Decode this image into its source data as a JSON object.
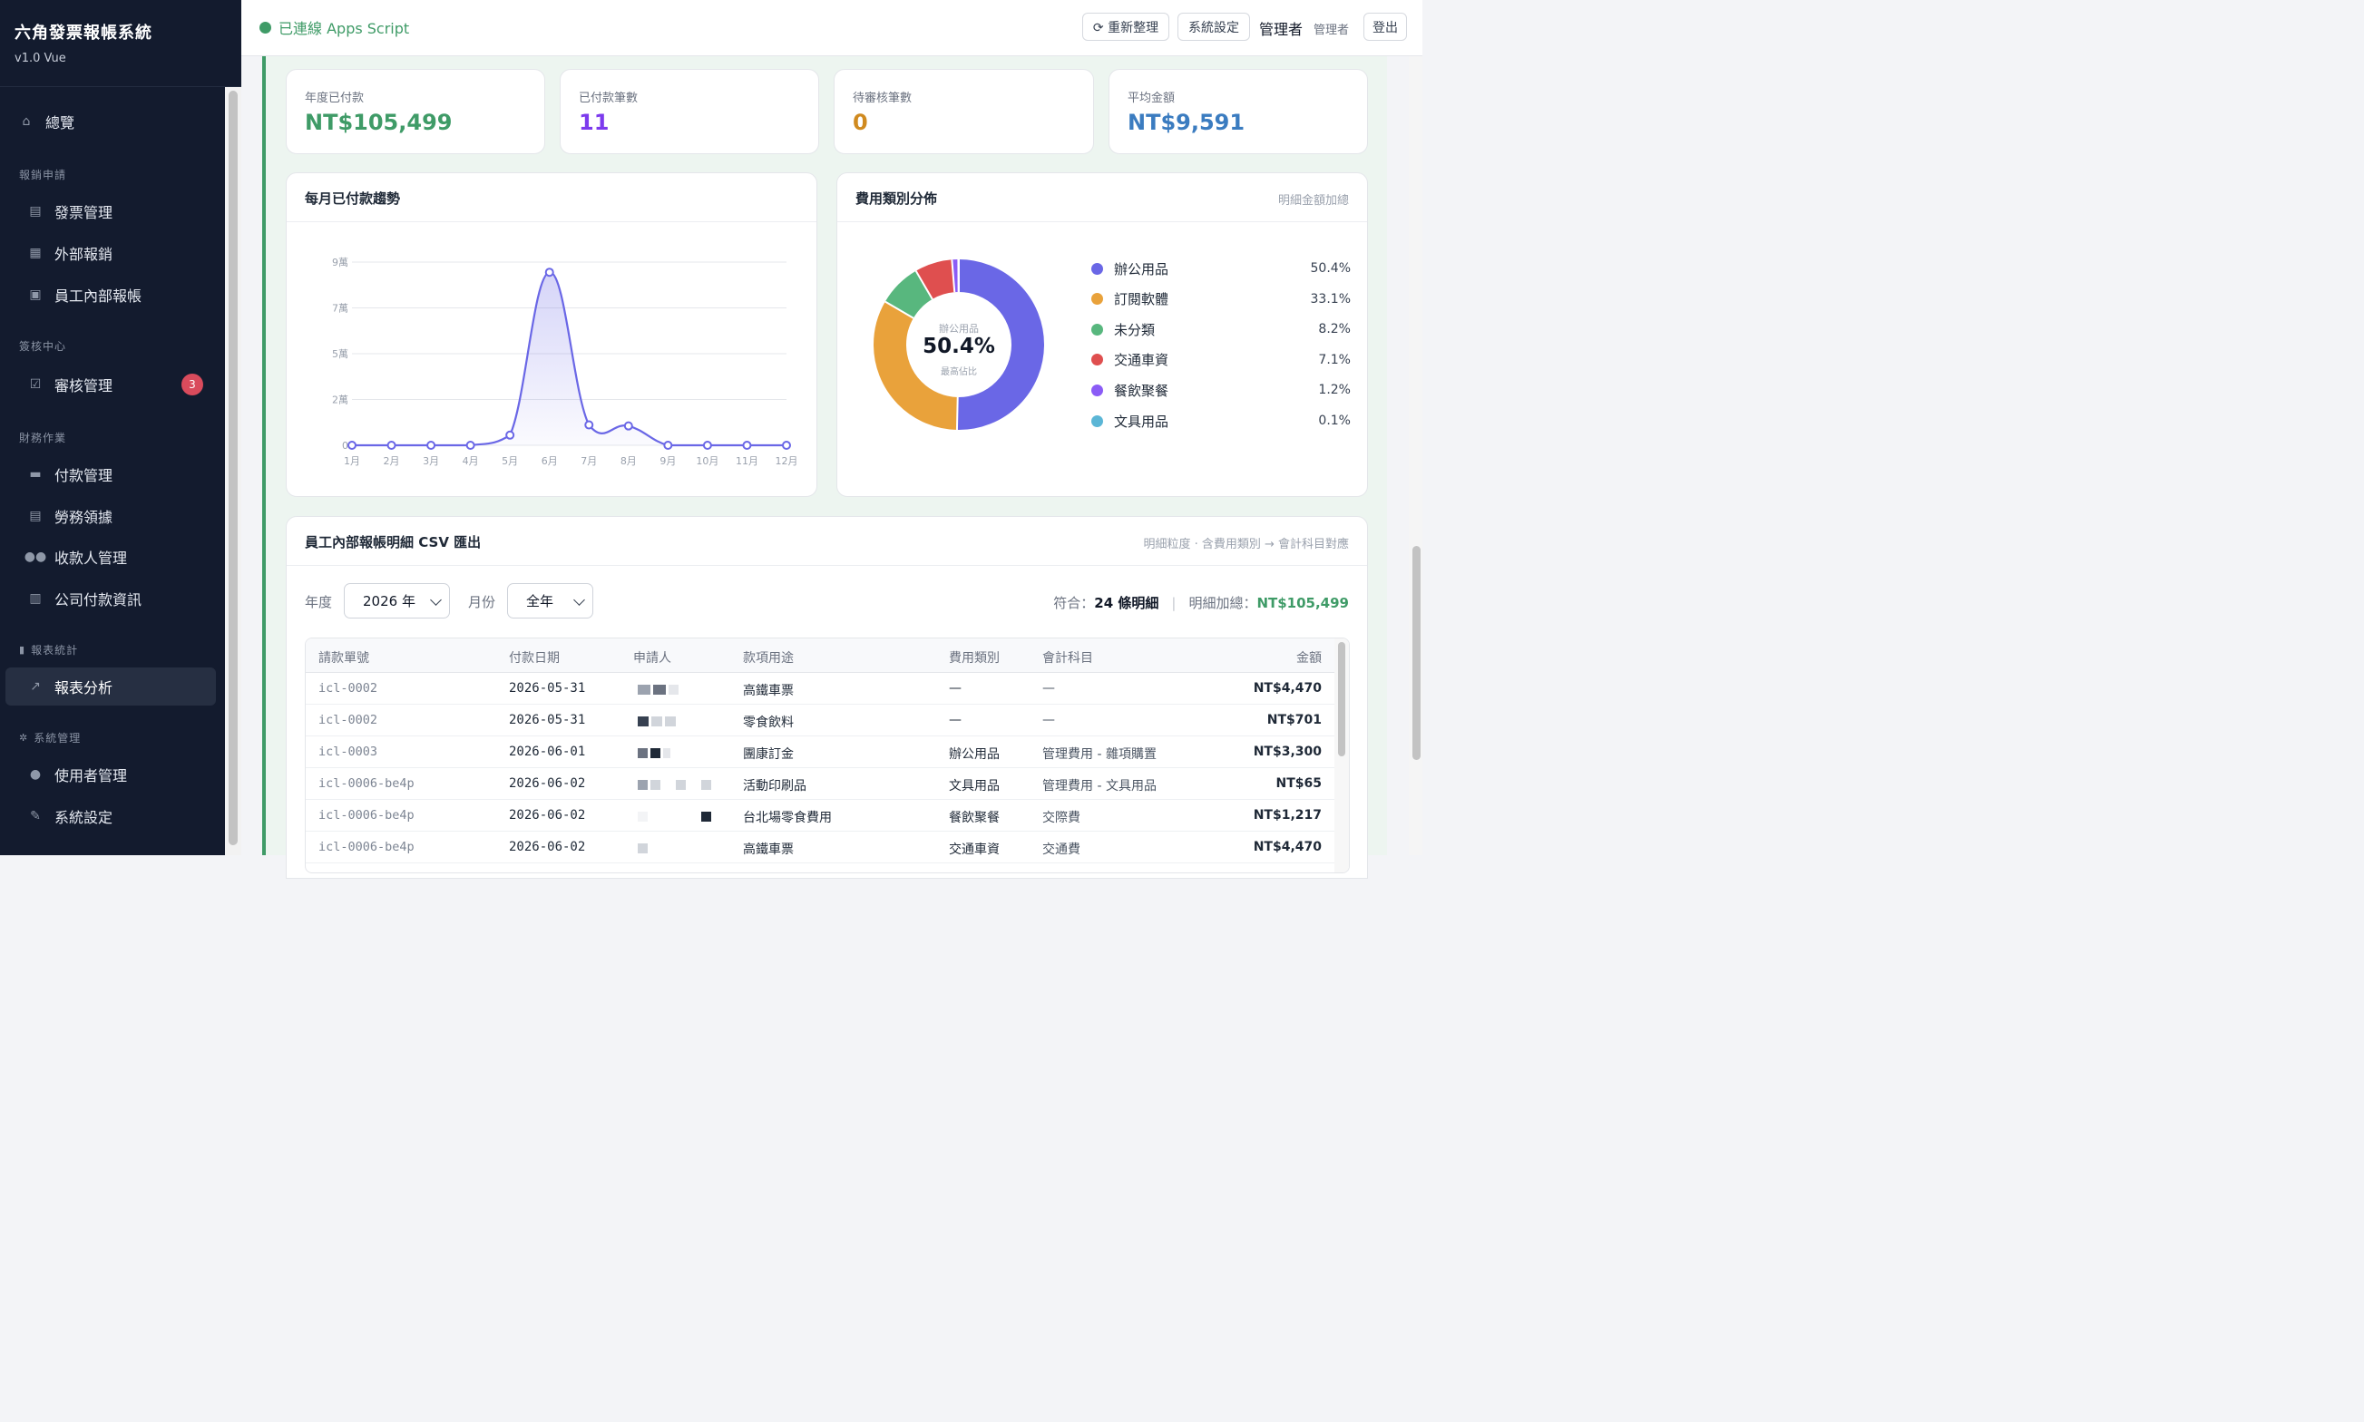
{
  "app": {
    "title": "六角發票報帳系統",
    "version": "v1.0 Vue"
  },
  "sidebar": {
    "overview": {
      "label": "總覽",
      "icon": "house-icon"
    },
    "sections": [
      {
        "label": "報銷申請",
        "items": [
          {
            "label": "發票管理",
            "icon": "document-icon"
          },
          {
            "label": "外部報銷",
            "icon": "memo-icon"
          },
          {
            "label": "員工內部報帳",
            "icon": "briefcase-icon"
          }
        ]
      },
      {
        "label": "簽核中心",
        "items": [
          {
            "label": "審核管理",
            "icon": "checkbox-icon",
            "badge": "3"
          }
        ]
      },
      {
        "label": "財務作業",
        "items": [
          {
            "label": "付款管理",
            "icon": "credit-card-icon"
          },
          {
            "label": "勞務領據",
            "icon": "receipt-icon"
          },
          {
            "label": "收款人管理",
            "icon": "people-icon"
          },
          {
            "label": "公司付款資訊",
            "icon": "building-icon"
          }
        ]
      },
      {
        "label": "報表統計",
        "items": [
          {
            "label": "報表分析",
            "icon": "chart-icon"
          }
        ]
      },
      {
        "label": "系統管理",
        "items": [
          {
            "label": "使用者管理",
            "icon": "user-icon"
          },
          {
            "label": "系統設定",
            "icon": "wrench-icon"
          }
        ]
      }
    ]
  },
  "header": {
    "status": "已連線 Apps Script",
    "refresh_label": "⟳ 重新整理",
    "settings_label": "系統設定",
    "user_name": "管理者",
    "user_role": "管理者",
    "logout_label": "登出"
  },
  "stats": [
    {
      "label": "年度已付款",
      "value": "NT$105,499",
      "color": "#3f9b67"
    },
    {
      "label": "已付款筆數",
      "value": "11",
      "color": "#7c3aed"
    },
    {
      "label": "待審核筆數",
      "value": "0",
      "color": "#d08a1f"
    },
    {
      "label": "平均金額",
      "value": "NT$9,591",
      "color": "#3b7cc0"
    }
  ],
  "trend": {
    "title": "每月已付款趨勢"
  },
  "category": {
    "title": "費用類別分佈",
    "note": "明細金額加總",
    "center_label": "辦公用品",
    "center_value": "50.4%",
    "center_sub": "最高佔比"
  },
  "chart_data": [
    {
      "type": "line",
      "categories": [
        "1月",
        "2月",
        "3月",
        "4月",
        "5月",
        "6月",
        "7月",
        "8月",
        "9月",
        "10月",
        "11月",
        "12月"
      ],
      "series": [
        {
          "values": [
            0,
            0,
            0,
            0,
            5000,
            85000,
            10000,
            9500,
            0,
            0,
            0,
            0
          ]
        }
      ],
      "ylim": [
        0,
        90000
      ],
      "yticks": [
        "0",
        "2萬",
        "5萬",
        "7萬",
        "9萬"
      ],
      "ytick_values": [
        0,
        22500,
        45000,
        67500,
        90000
      ],
      "color": "#6a67e6",
      "grid": true
    },
    {
      "type": "pie",
      "labels": [
        "辦公用品",
        "訂閱軟體",
        "未分類",
        "交通車資",
        "餐飲聚餐",
        "文具用品"
      ],
      "values": [
        50.4,
        33.1,
        8.2,
        7.1,
        1.2,
        0.1
      ],
      "display": [
        "50.4%",
        "33.1%",
        "8.2%",
        "7.1%",
        "1.2%",
        "0.1%"
      ],
      "colors": [
        "#6a67e6",
        "#e9a23b",
        "#58b77e",
        "#df4f4f",
        "#8b5cf6",
        "#5bb6d6"
      ],
      "donut": true
    }
  ],
  "table_card": {
    "title": "員工內部報帳明細 CSV 匯出",
    "note": "明細粒度 · 含費用類別 → 會計科目對應",
    "year_label": "年度",
    "year_value": "2026 年",
    "month_label": "月份",
    "month_value": "全年",
    "match_prefix": "符合：",
    "match_count": "24 條明細",
    "total_prefix": "明細加總：",
    "total_value": "NT$105,499",
    "columns": [
      "請款單號",
      "付款日期",
      "申請人",
      "款項用途",
      "費用類別",
      "會計科目",
      "金額"
    ],
    "rows": [
      {
        "id": "icl-0002",
        "date": "2026-05-31",
        "purpose": "高鐵車票",
        "category": "—",
        "account": "—",
        "amount": "NT$4,470"
      },
      {
        "id": "icl-0002",
        "date": "2026-05-31",
        "purpose": "零食飲料",
        "category": "—",
        "account": "—",
        "amount": "NT$701"
      },
      {
        "id": "icl-0003",
        "date": "2026-06-01",
        "purpose": "團康訂金",
        "category": "辦公用品",
        "account": "管理費用 - 雜項購置",
        "amount": "NT$3,300"
      },
      {
        "id": "icl-0006-be4p",
        "date": "2026-06-02",
        "purpose": "活動印刷品",
        "category": "文具用品",
        "account": "管理費用 - 文具用品",
        "amount": "NT$65"
      },
      {
        "id": "icl-0006-be4p",
        "date": "2026-06-02",
        "purpose": "台北場零食費用",
        "category": "餐飲聚餐",
        "account": "交際費",
        "amount": "NT$1,217"
      },
      {
        "id": "icl-0006-be4p",
        "date": "2026-06-02",
        "purpose": "高鐵車票",
        "category": "交通車資",
        "account": "交通費",
        "amount": "NT$4,470"
      }
    ]
  }
}
